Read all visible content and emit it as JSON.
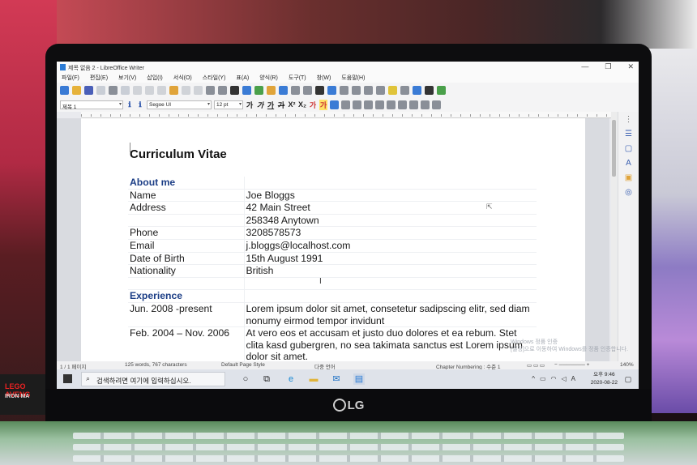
{
  "window": {
    "title": "제목 없음 2 - LibreOffice Writer",
    "controls": [
      "—",
      "❐",
      "✕"
    ]
  },
  "menu": [
    "파일(F)",
    "편집(E)",
    "보기(V)",
    "삽입(I)",
    "서식(O)",
    "스타일(Y)",
    "표(A)",
    "양식(R)",
    "도구(T)",
    "창(W)",
    "도움말(H)"
  ],
  "formatting": {
    "paragraph_style": "제목 1",
    "font_name": "Segoe UI",
    "font_size": "12 pt",
    "buttons": [
      "가",
      "가",
      "가",
      "가",
      "X²",
      "X₂",
      "가",
      "가"
    ]
  },
  "document": {
    "title": "Curriculum Vitae",
    "rows": [
      {
        "key": "About me",
        "value": "",
        "heading": true
      },
      {
        "key": "Name",
        "value": "Joe Bloggs"
      },
      {
        "key": "Address",
        "value": "42 Main Street"
      },
      {
        "key": "",
        "value": "258348 Anytown"
      },
      {
        "key": "Phone",
        "value": "3208578573"
      },
      {
        "key": "Email",
        "value": "j.bloggs@localhost.com"
      },
      {
        "key": "Date of Birth",
        "value": "15th August 1991"
      },
      {
        "key": "Nationality",
        "value": "British"
      },
      {
        "key": "",
        "value": ""
      },
      {
        "key": "Experience",
        "value": "",
        "heading": true
      },
      {
        "key": "Jun. 2008 -present",
        "value": "Lorem ipsum dolor sit amet, consetetur sadipscing elitr, sed diam nonumy eirmod tempor invidunt"
      },
      {
        "key": "Feb. 2004 – Nov. 2006",
        "value": "At vero eos et accusam et justo duo dolores et ea rebum. Stet clita kasd gubergren, no sea takimata sanctus est Lorem ipsum dolor sit amet."
      }
    ]
  },
  "statusbar": {
    "page": "1 / 1 페이지",
    "words": "125 words, 767 characters",
    "page_style": "Default Page Style",
    "language": "다중 언어",
    "outline": "Chapter Numbering : 수준 1",
    "zoom": "140%"
  },
  "activation": {
    "line1": "Windows 정품 인증",
    "line2": "[설정]으로 이동하여 Windows를 정품 인증합니다."
  },
  "taskbar": {
    "search_placeholder": "검색하려면 여기에 입력하십시오.",
    "time": "오후 9:46",
    "date": "2020-08-22",
    "ime": "A"
  },
  "device": {
    "brand": "LG",
    "lego_brand": "LEGO",
    "lego_title": "AVENG",
    "lego_sub": "IRON MA"
  },
  "colors": {
    "heading": "#1c3e86",
    "accent": "#2a7bd5"
  }
}
